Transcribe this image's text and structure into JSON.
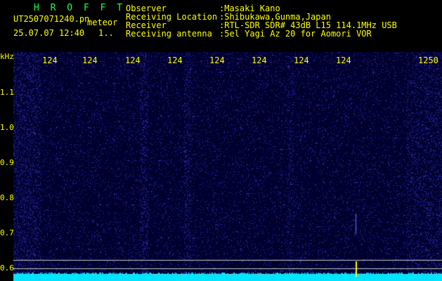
{
  "app": {
    "brand": "H R O F F T"
  },
  "file": {
    "name": "UT2507071240.pn",
    "tag": "meteor",
    "datetime": "25.07.07 12:40",
    "index": "1.."
  },
  "info": {
    "labels": [
      "Observer",
      "Receiving Location",
      "Receiver",
      "Receiving antenna"
    ],
    "values": [
      ":Masaki Kano",
      ":Shibukawa,Gunma,Japan",
      ":RTL-SDR SDR# 43dB L15 114.1MHz USB",
      ":5el Yagi Az 20 for Aomori VOR"
    ]
  },
  "axes": {
    "unit": "kHz",
    "top_ticks": [
      "124",
      "124",
      "124",
      "124",
      "124",
      "124",
      "124",
      "124",
      "1250"
    ],
    "left_ticks": [
      "1.1",
      "1.0",
      "0.9",
      "0.8",
      "0.7",
      "0.6"
    ]
  },
  "colors": {
    "header_text": "#ffff00",
    "brand": "#22ff44",
    "background": "#000000",
    "waterfall_bg": "#00002e",
    "noise": "#3030d0",
    "baseline": "#00e5ff",
    "signal": "#ffff00"
  }
}
